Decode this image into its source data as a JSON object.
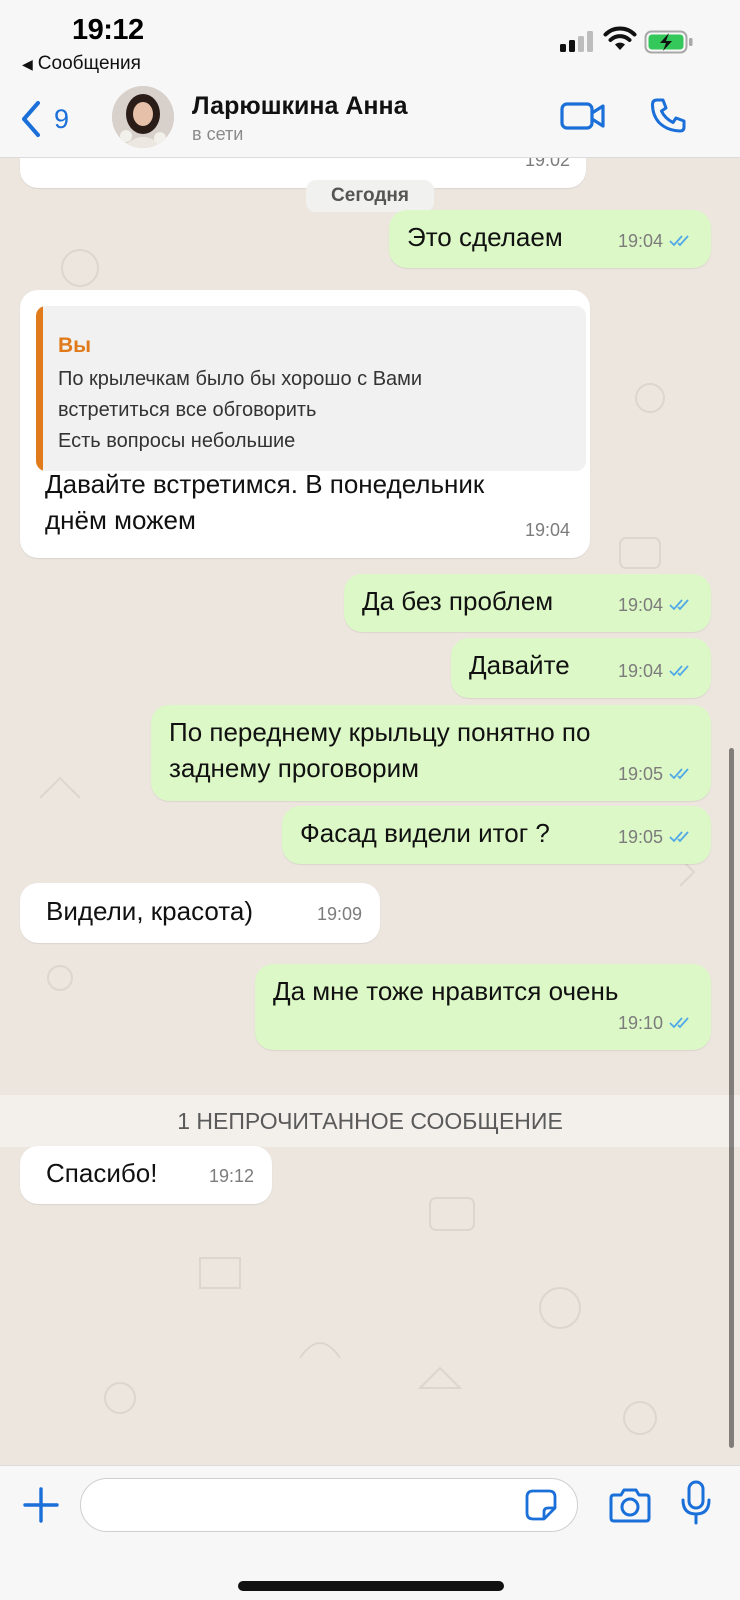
{
  "status_bar": {
    "time": "19:12",
    "back_app": "Сообщения",
    "icons": [
      "signal-icon",
      "wifi-icon",
      "battery-charging-icon"
    ]
  },
  "header": {
    "back_count": "9",
    "contact_name": "Ларюшкина Анна",
    "contact_status": "в сети",
    "icons": [
      "chevron-left-icon",
      "video-call-icon",
      "phone-icon"
    ],
    "accent_color": "#1a6fd9"
  },
  "chat": {
    "date_label": "Сегодня",
    "unread_banner": "1 НЕПРОЧИТАННОЕ СООБЩЕНИЕ",
    "colors": {
      "incoming": "#ffffff",
      "outgoing": "#dcf8c6",
      "quote_accent": "#e07a1a",
      "read_ticks": "#4fa8e8"
    },
    "messages": [
      {
        "time": "19:02",
        "direction": "in"
      },
      {
        "text": "Это сделаем",
        "time": "19:04",
        "direction": "out"
      },
      {
        "quote": {
          "author": "Вы",
          "text": "По крылечкам было бы хорошо с Вами\nвстретиться все обговорить\nЕсть вопросы небольшие"
        },
        "text": "Давайте встретимся. В понедельник\nднём можем",
        "time": "19:04",
        "direction": "in"
      },
      {
        "text": "Да без проблем",
        "time": "19:04",
        "direction": "out"
      },
      {
        "text": "Давайте",
        "time": "19:04",
        "direction": "out"
      },
      {
        "text": "По переднему крыльцу понятно по\nзаднему проговорим",
        "time": "19:05",
        "direction": "out"
      },
      {
        "text": "Фасад видели итог ?",
        "time": "19:05",
        "direction": "out"
      },
      {
        "text": "Видели, красота)",
        "time": "19:09",
        "direction": "in"
      },
      {
        "text": "Да мне тоже нравится очень",
        "time": "19:10",
        "direction": "out"
      },
      {
        "text": "Спасибо!",
        "time": "19:12",
        "direction": "in"
      }
    ]
  },
  "input_bar": {
    "placeholder": "",
    "icons": [
      "plus-icon",
      "sticker-icon",
      "camera-icon",
      "microphone-icon"
    ]
  }
}
